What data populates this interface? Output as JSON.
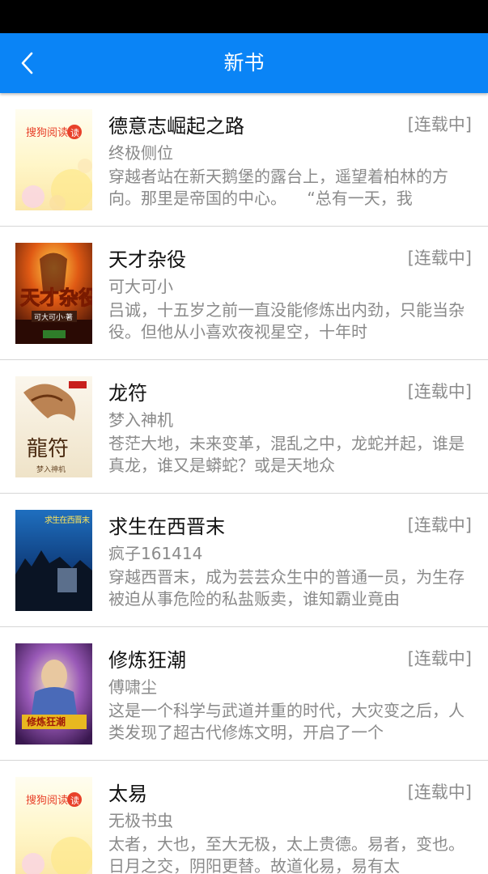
{
  "header": {
    "title": "新书",
    "back_icon": "chevron-left-icon"
  },
  "colors": {
    "appbar": "#0a84f6",
    "statusbar": "#000000",
    "title_text": "#ffffff",
    "secondary_text": "#8a8a8a"
  },
  "books": [
    {
      "title": "德意志崛起之路",
      "status": "[连载中]",
      "author": "终极侧位",
      "desc": "穿越者站在新天鹅堡的露台上，遥望着柏林的方向。那里是帝国的中心。    “总有一天，我",
      "cover_label": "搜狗阅读"
    },
    {
      "title": "天才杂役",
      "status": "[连载中]",
      "author": "可大可小",
      "desc": "吕诚，十五岁之前一直没能修炼出内劲，只能当杂役。但他从小喜欢夜视星空，十年时",
      "cover_label": "天才杂役",
      "cover_sub": "可大可小·著"
    },
    {
      "title": "龙符",
      "status": "[连载中]",
      "author": "梦入神机",
      "desc": "苍茫大地，未来变革，混乱之中，龙蛇并起，谁是真龙，谁又是蟒蛇？或是天地众",
      "cover_label": "龍符",
      "cover_sub": "梦入神机"
    },
    {
      "title": "求生在西晋末",
      "status": "[连载中]",
      "author": "疯子161414",
      "desc": "穿越西晋末，成为芸芸众生中的普通一员，为生存被迫从事危险的私盐贩卖，谁知霸业竟由",
      "cover_label": "求生在西晋末"
    },
    {
      "title": "修炼狂潮",
      "status": "[连载中]",
      "author": "傅啸尘",
      "desc": "这是一个科学与武道并重的时代，大灾变之后，人类发现了超古代修炼文明，开启了一个",
      "cover_label": "修炼狂潮"
    },
    {
      "title": "太易",
      "status": "[连载中]",
      "author": "无极书虫",
      "desc": "太者，大也，至大无极，太上贵德。易者，变也。日月之交，阴阳更替。故道化易，易有太",
      "cover_label": "搜狗阅读"
    }
  ]
}
